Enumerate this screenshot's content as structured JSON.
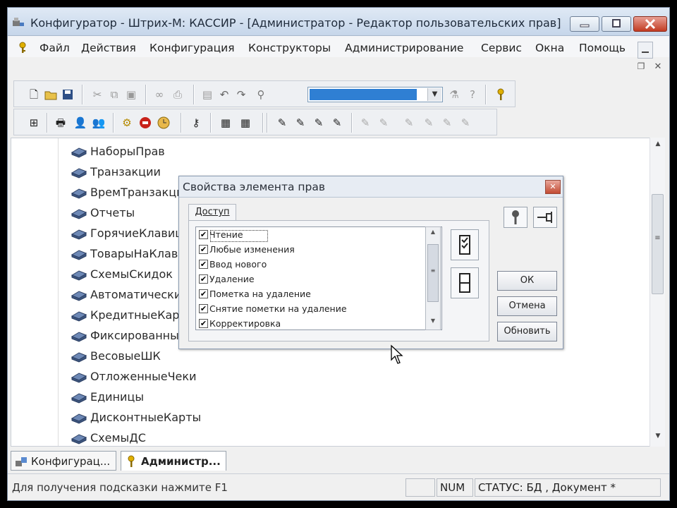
{
  "window": {
    "title": "Конфигуратор - Штрих-М: КАССИР - [Администратор - Редактор пользовательских прав]"
  },
  "menu": {
    "items": [
      "Файл",
      "Действия",
      "Конфигурация",
      "Конструкторы",
      "Администрирование",
      "Сервис",
      "Окна",
      "Помощь"
    ]
  },
  "toolbar1": {
    "icons": [
      "new-icon",
      "open-icon",
      "save-icon",
      "cut-icon",
      "copy-icon",
      "paste-icon",
      "glasses-icon",
      "print-icon",
      "window-icon",
      "undo-icon",
      "redo-icon",
      "binoculars-icon",
      "wizard-icon",
      "help-icon",
      "key-icon"
    ]
  },
  "toolbar2": {
    "icons": [
      "structure-icon",
      "cash-register-icon",
      "user-icon",
      "users-icon",
      "settings-icon",
      "stop-icon",
      "clock-icon",
      "admin-icon",
      "table-icon",
      "table-edit-icon",
      "rights-icon",
      "rights-edit-icon",
      "rights-user-icon",
      "rights-check-icon",
      "rights-gray-1-icon",
      "rights-gray-2-icon",
      "rights-gray-3-icon",
      "rights-gray-4-icon",
      "rights-gray-5-icon"
    ]
  },
  "tree": {
    "items": [
      "НаборыПрав",
      "Транзакции",
      "ВремТранзакции",
      "Отчеты",
      "ГорячиеКлавиши",
      "ТоварыНаКлавишах",
      "СхемыСкидок",
      "Автоматические",
      "КредитныеКарты",
      "Фиксированные",
      "ВесовыеШК",
      "ОтложенныеЧеки",
      "Единицы",
      "ДисконтныеКарты",
      "СхемыДС"
    ]
  },
  "dialog": {
    "title": "Свойства элемента прав",
    "tab_label": "Доступ",
    "permissions": [
      {
        "label": "Чтение",
        "checked": true
      },
      {
        "label": "Любые изменения",
        "checked": true
      },
      {
        "label": "Ввод нового",
        "checked": true
      },
      {
        "label": "Удаление",
        "checked": true
      },
      {
        "label": "Пометка на удаление",
        "checked": true
      },
      {
        "label": "Снятие пометки на удаление",
        "checked": true
      },
      {
        "label": "Корректировка",
        "checked": true
      }
    ],
    "buttons": {
      "ok": "ОК",
      "cancel": "Отмена",
      "refresh": "Обновить"
    }
  },
  "tabs": {
    "config": "Конфигурац...",
    "admin": "Администр..."
  },
  "status": {
    "hint": "Для получения подсказки нажмите F1",
    "num": "NUM",
    "db": "СТАТУС: БД , Документ *"
  },
  "colors": {
    "selection": "#2f7fd3",
    "close_button": "#c23b22"
  }
}
